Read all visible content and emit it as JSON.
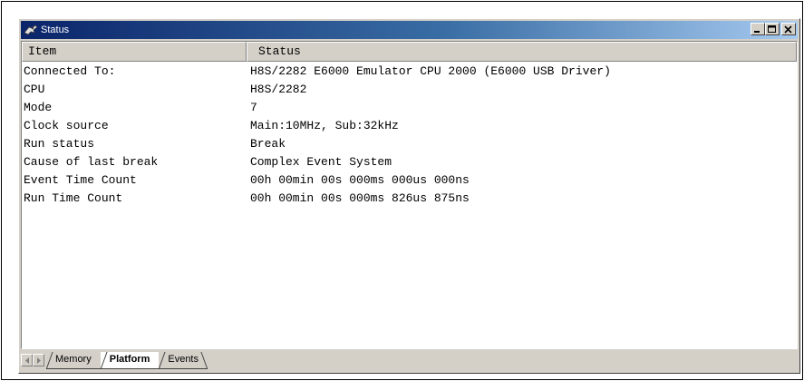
{
  "window": {
    "title": "Status",
    "title_icon": "status-window-icon",
    "buttons": {
      "minimize_icon": "minimize-icon",
      "maximize_icon": "maximize-icon",
      "close_icon": "close-icon"
    }
  },
  "table": {
    "columns": [
      "Item",
      "Status"
    ],
    "rows": [
      {
        "item": "Connected To:",
        "status": "H8S/2282 E6000 Emulator CPU 2000 (E6000 USB Driver)"
      },
      {
        "item": "CPU",
        "status": "H8S/2282"
      },
      {
        "item": "Mode",
        "status": "7"
      },
      {
        "item": "Clock source",
        "status": "Main:10MHz, Sub:32kHz"
      },
      {
        "item": "Run status",
        "status": "Break"
      },
      {
        "item": "Cause of last break",
        "status": "Complex Event System"
      },
      {
        "item": "Event Time Count",
        "status": "00h 00min 00s 000ms 000us 000ns"
      },
      {
        "item": "Run Time Count",
        "status": "00h 00min 00s 000ms 826us 875ns"
      }
    ]
  },
  "tabs": [
    {
      "label": "Memory",
      "active": false
    },
    {
      "label": "Platform",
      "active": true
    },
    {
      "label": "Events",
      "active": false
    }
  ],
  "colors": {
    "titlebar_start": "#0a246a",
    "titlebar_end": "#a6caf0",
    "face": "#d4d0c8"
  }
}
